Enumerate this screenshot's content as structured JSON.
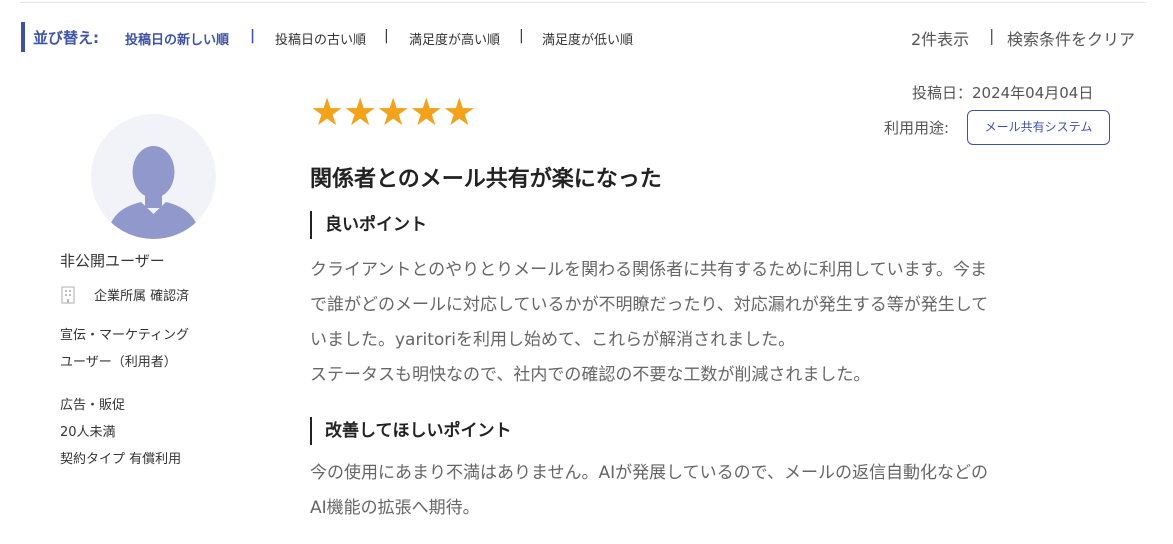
{
  "sort": {
    "title": "並び替え:",
    "options": [
      {
        "label": "投稿日の新しい順",
        "active": true
      },
      {
        "label": "投稿日の古い順",
        "active": false
      },
      {
        "label": "満足度が高い順",
        "active": false
      },
      {
        "label": "満足度が低い順",
        "active": false
      }
    ],
    "separator": "|"
  },
  "results": {
    "count_text": "2件表示",
    "separator": "|",
    "clear_label": "検索条件をクリア"
  },
  "reviewer": {
    "avatar_icon": "user-silhouette-icon",
    "name": "非公開ユーザー",
    "company_icon": "building-icon",
    "company_status": "企業所属 確認済",
    "department": "宣伝・マーケティング",
    "role": "ユーザー（利用者）",
    "industry": "広告・販促",
    "company_size": "20人未満",
    "contract_type": "契約タイプ 有償利用"
  },
  "review": {
    "rating": 5,
    "stars_text": "★★★★★",
    "star_color": "#f3a21b",
    "post_date": "投稿日：2024年04月04日",
    "usage_label": "利用用途:",
    "usage_tag": "メール共有システム",
    "title": "関係者とのメール共有が楽になった",
    "good_heading": "良いポイント",
    "good_lines": [
      "クライアントとのやりとりメールを関わる関係者に共有するために利用しています。今ま",
      "で誰がどのメールに対応しているかが不明瞭だったり、対応漏れが発生する等が発生して",
      "いました。yaritoriを利用し始めて、これらが解消されました。",
      "ステータスも明快なので、社内での確認の不要な工数が削減されました。"
    ],
    "improve_heading": "改善してほしいポイント",
    "improve_lines": [
      "今の使用にあまり不満はありません。AIが発展しているので、メールの返信自動化などの",
      "AI機能の拡張へ期待。"
    ]
  },
  "colors": {
    "accent": "#3d53a6",
    "star": "#f3a21b",
    "avatar_bg": "#f1f3f9",
    "avatar_fg": "#9198cc"
  }
}
